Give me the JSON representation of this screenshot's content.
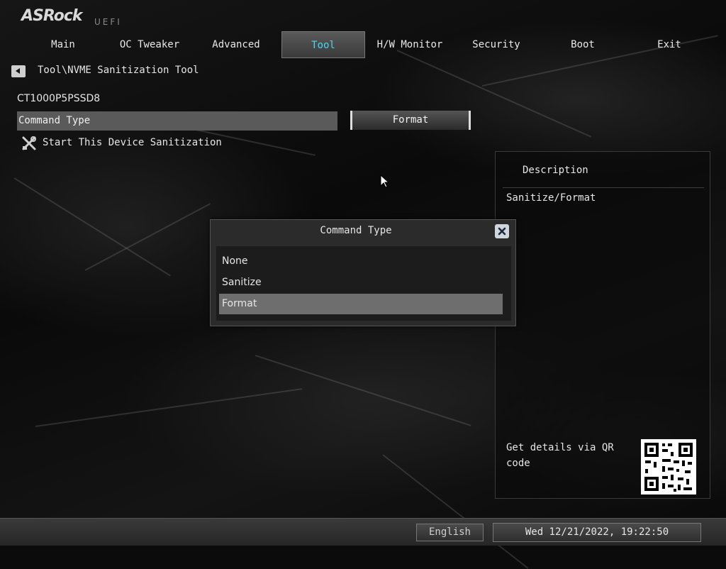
{
  "brand": {
    "logo": "ASRock",
    "subtitle": "UEFI"
  },
  "tabs": [
    {
      "label": "Main"
    },
    {
      "label": "OC Tweaker"
    },
    {
      "label": "Advanced"
    },
    {
      "label": "Tool",
      "active": true
    },
    {
      "label": "H/W Monitor"
    },
    {
      "label": "Security"
    },
    {
      "label": "Boot"
    },
    {
      "label": "Exit"
    }
  ],
  "breadcrumb": {
    "path": "Tool\\NVME Sanitization Tool",
    "back_icon": "back-arrow-icon"
  },
  "device": {
    "name": "CT1000P5PSSD8"
  },
  "settings": {
    "command_type_label": "Command Type",
    "command_type_value": "Format",
    "start_action": "Start This Device Sanitization",
    "start_icon": "tools-icon"
  },
  "description": {
    "title": "Description",
    "body": "Sanitize/Format",
    "qr_text": "Get details via QR code"
  },
  "popup": {
    "title": "Command Type",
    "options": [
      "None",
      "Sanitize",
      "Format"
    ],
    "selected": "Format",
    "close_icon": "close-icon"
  },
  "footer": {
    "language": "English",
    "datetime": "Wed 12/21/2022, 19:22:50"
  },
  "colors": {
    "accent": "#4fd3f0",
    "highlight": "#5a5a5a",
    "selected": "#6e6e6e"
  }
}
